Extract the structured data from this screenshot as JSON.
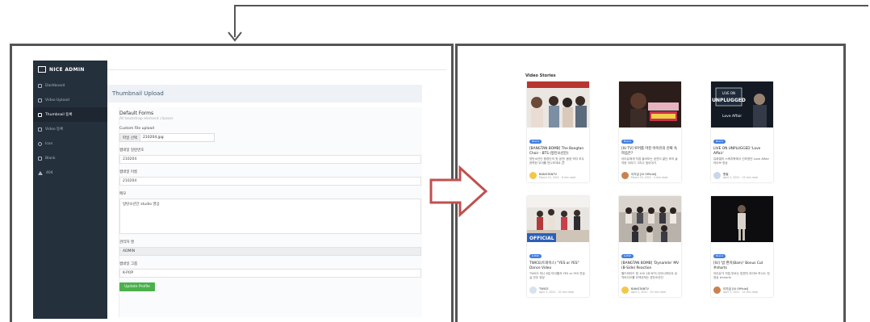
{
  "admin": {
    "brand": "NICE ADMIN",
    "nav": [
      {
        "label": "Dashboard",
        "icon": "gauge-icon"
      },
      {
        "label": "Video Upload",
        "icon": "upload-icon"
      },
      {
        "label": "Thumbnail 등록",
        "icon": "image-icon"
      },
      {
        "label": "Video 등록",
        "icon": "film-icon"
      },
      {
        "label": "Icon",
        "icon": "face-icon"
      },
      {
        "label": "Blank",
        "icon": "file-icon"
      },
      {
        "label": "404",
        "icon": "warning-icon"
      }
    ],
    "page_title": "Thumbnail Upload",
    "form": {
      "title": "Default Forms",
      "subtitle": "All bootstrap element classes",
      "file_label": "Custom File upload",
      "file_button": "파일 선택",
      "file_name": "210204.jpg",
      "field1_label": "썸네일 일련번호",
      "field1_value": "210204",
      "field2_label": "썸네일 이름",
      "field2_value": "210204",
      "memo_label": "메모",
      "memo_value": "방탄소년단 studio 영상",
      "manager_label": "관리자 명",
      "manager_value": "ADMIN",
      "group_label": "썸네일 그룹",
      "group_value": "K-POP",
      "submit": "Update Profile"
    }
  },
  "stories": {
    "title": "Video Stories",
    "cards": [
      {
        "badge": "Brand",
        "title": "[BANGTAN BOMB] The Bangtan Choir - BTS (방탄소년단)",
        "desc": "방탄소년단 합창단의 첫 공연! 음정 박자 모두 완벽한 무대를 만나보세요 🎵",
        "author": "BANGTANTV",
        "date": "March 10, 2021 · 6 min read",
        "avatar": "#f3c74a"
      },
      {
        "badge": "Brand",
        "title": "[IU TV] 루머를 마친 아이유의 진짜 속마음은?",
        "desc": "아이유에게 직접 들어보는 공연이 끝난 후의 솔직한 이야기 그리고 뒷이야기",
        "author": "이지금 [IU Official]",
        "date": "March 23, 2021 · 4 min read",
        "avatar": "#c9824f"
      },
      {
        "badge": "Brand",
        "title": "LIVE ON UNPLUGGED 'Love Affair'",
        "desc": "유희열의 스케치북에서 선보였던 Love Affair 라이브 영상",
        "author": "원필",
        "date": "April 2, 2021 · 15 min read",
        "avatar": "#c9d8e8"
      },
      {
        "badge": "K-POP",
        "title": "TWICE(트와이스) \"YES or YES\" Dance Video",
        "desc": "TWICE 미니 6집 타이틀곡 YES or YES 연습실 안무 영상",
        "author": "TWICE",
        "date": "April 2, 2021 · 10 min read",
        "avatar": "#d6e2ee"
      },
      {
        "badge": "K-POP",
        "title": "[BANGTAN BOMB] 'Dynamite' MV (B-Side) Reaction",
        "desc": "월드와이드 핫 100 1위 BTS 다이나마이트 뮤직비디오를 리액션하는 방탄소년단",
        "author": "BANGTANTV",
        "date": "April 2, 2021 · 10 min read",
        "avatar": "#f3c74a"
      },
      {
        "badge": "Brand",
        "title": "[IU] '밤 편지(Bam)' Bonus Cut #shorts",
        "desc": "아이유가 직접 부르는 밤편지 라이브 보너스 컷 영상 #shorts",
        "author": "이지금 [IU Official]",
        "date": "April 2, 2021 · 15 min read",
        "avatar": "#c9824f"
      }
    ]
  },
  "colors": {
    "sidebar": "#25303d",
    "accent_green": "#4cb04d",
    "arrow_red": "#c0504d",
    "badge_blue": "#3f7fe0",
    "frame": "#555555"
  }
}
